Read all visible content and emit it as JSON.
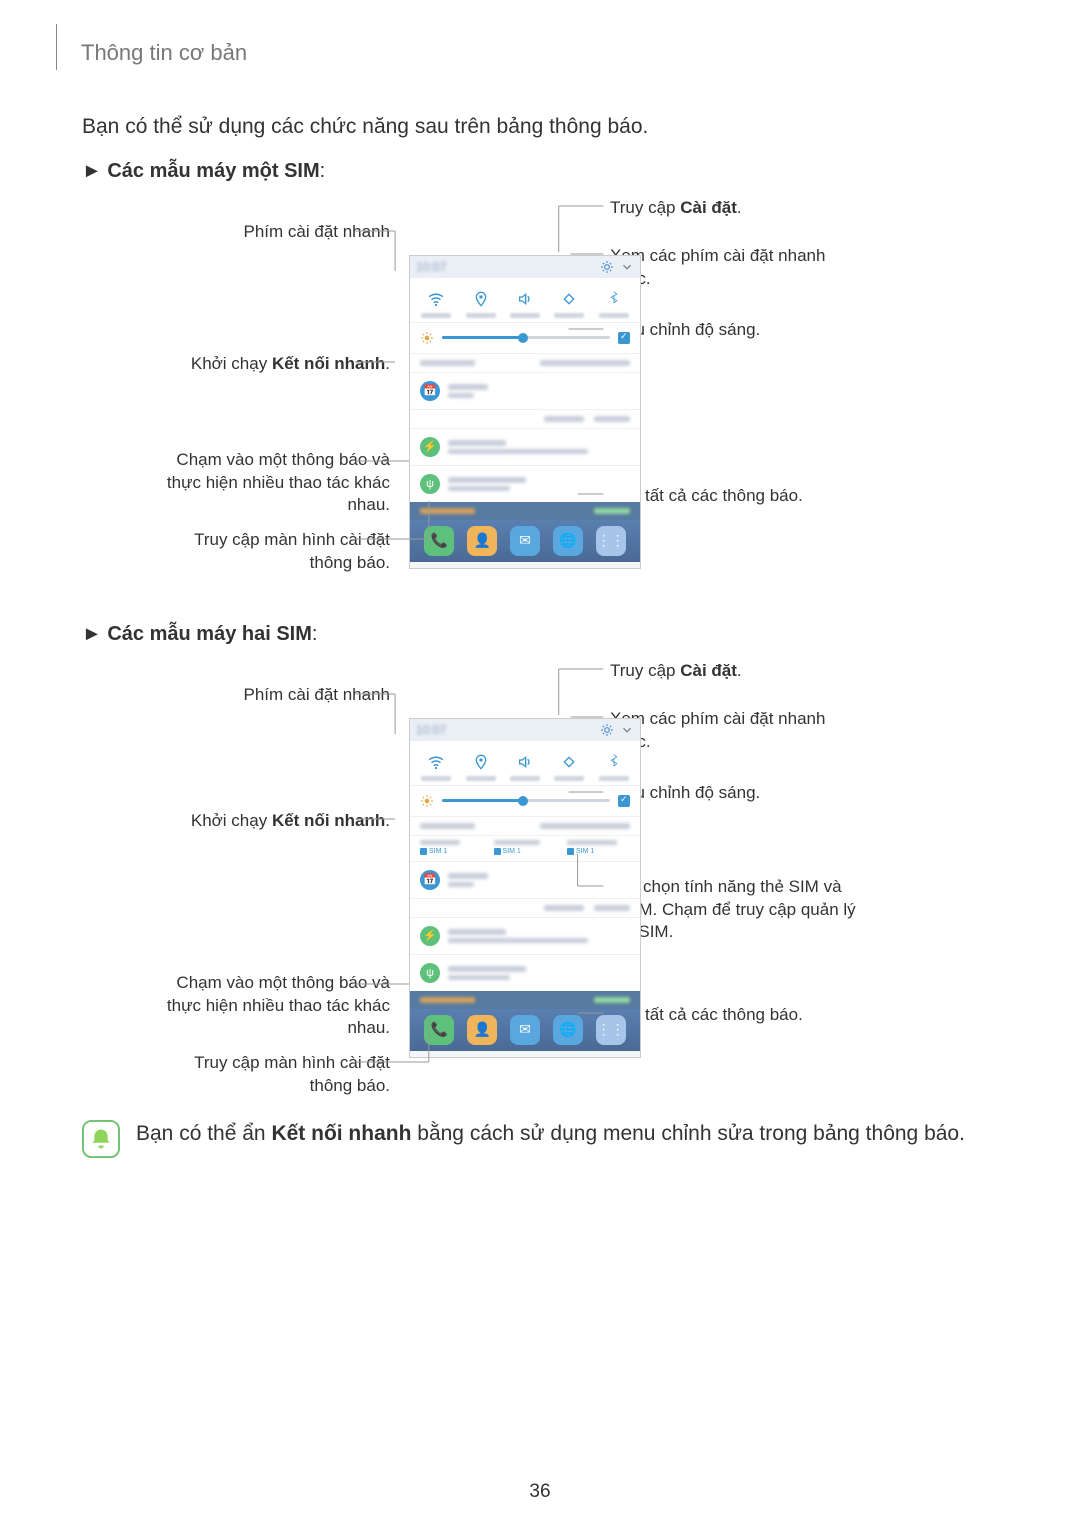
{
  "header": {
    "title": "Thông tin cơ bản"
  },
  "intro": "Bạn có thể sử dụng các chức năng sau trên bảng thông báo.",
  "sections": {
    "single_sim": {
      "prefix": "► ",
      "label_plain": "Các mẫu máy một SIM",
      "suffix": ":"
    },
    "dual_sim": {
      "prefix": "► ",
      "label_plain": "Các mẫu máy hai SIM",
      "suffix": ":"
    }
  },
  "callouts": {
    "settings": {
      "pre": "Truy cập ",
      "bold": "Cài đặt",
      "post": "."
    },
    "more_quick": "Xem các phím cài đặt nhanh khác.",
    "brightness": "Điều chỉnh độ sáng.",
    "quick_settings_keys": "Phím cài đặt nhanh",
    "quick_connect": {
      "pre": "Khởi chạy ",
      "bold": "Kết nối nhanh",
      "post": "."
    },
    "tap_notif": "Chạm vào một thông báo và thực hiện nhiều thao tác khác nhau.",
    "notif_settings": "Truy cập màn hình cài đặt thông báo.",
    "clear_all": "Xóa tất cả các thông báo.",
    "sim_options": "Tùy chọn tính năng thẻ SIM và USIM. Chạm để truy cập quản lý thẻ SIM."
  },
  "phone": {
    "sim_labels": [
      "SIM 1",
      "SIM 1",
      "SIM 1"
    ]
  },
  "tip": {
    "pre": "Bạn có thể ẩn ",
    "bold": "Kết nối nhanh",
    "post": " bằng cách sử dụng menu chỉnh sửa trong bảng thông báo."
  },
  "page_number": "36"
}
